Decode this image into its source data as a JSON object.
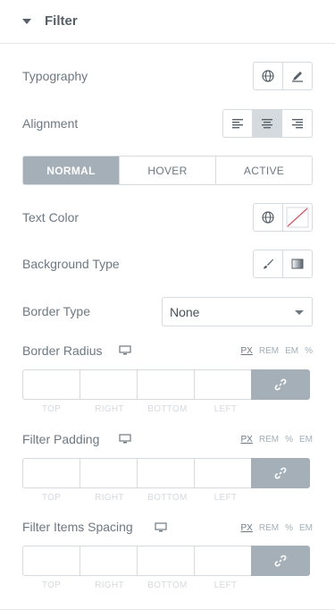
{
  "section": {
    "title": "Filter"
  },
  "rows": {
    "typography": "Typography",
    "alignment": "Alignment",
    "text_color": "Text Color",
    "background_type": "Background Type",
    "border_type": "Border Type",
    "border_radius": "Border Radius",
    "filter_padding": "Filter Padding",
    "filter_items_spacing": "Filter Items Spacing"
  },
  "tabs": [
    {
      "label": "NORMAL",
      "active": true
    },
    {
      "label": "HOVER",
      "active": false
    },
    {
      "label": "ACTIVE",
      "active": false
    }
  ],
  "border_type_select": {
    "value": "None"
  },
  "border_radius_units": [
    "PX",
    "REM",
    "EM",
    "%"
  ],
  "filter_padding_units": [
    "PX",
    "REM",
    "%",
    "EM"
  ],
  "filter_items_spacing_units": [
    "PX",
    "REM",
    "%",
    "EM"
  ],
  "dimension_labels": [
    "TOP",
    "RIGHT",
    "BOTTOM",
    "LEFT"
  ],
  "colors": {
    "accent": "#a4afb7",
    "border": "#d5dadf",
    "text": "#6d7882"
  }
}
